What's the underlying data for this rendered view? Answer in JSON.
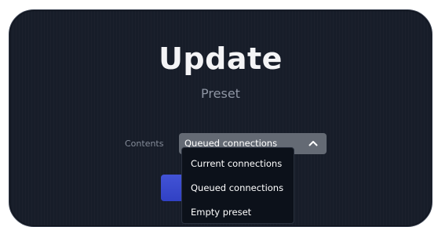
{
  "dialog": {
    "title": "Update",
    "subtitle": "Preset"
  },
  "contents": {
    "label": "Contents",
    "selected": "Queued connections",
    "options": [
      "Current connections",
      "Queued connections",
      "Empty preset"
    ],
    "expanded": true
  },
  "icons": {
    "select_toggle": "chevron-up-icon"
  },
  "colors": {
    "background": "#171d29",
    "accent": "#3a4bd0",
    "select_bg": "#646a74",
    "menu_bg": "#0c111a"
  }
}
